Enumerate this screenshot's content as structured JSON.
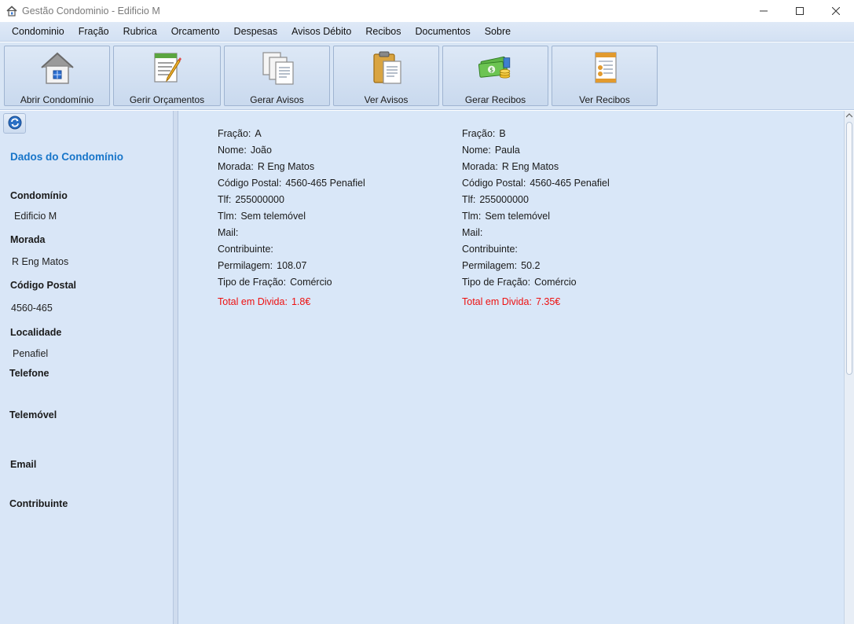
{
  "window": {
    "title": "Gestão Condominio - Edificio M",
    "icon": "home-icon"
  },
  "menu": [
    "Condominio",
    "Fração",
    "Rubrica",
    "Orcamento",
    "Despesas",
    "Avisos Débito",
    "Recibos",
    "Documentos",
    "Sobre"
  ],
  "toolbar": [
    {
      "label": "Abrir Condomínio",
      "icon": "house-icon"
    },
    {
      "label": "Gerir Orçamentos",
      "icon": "notepad-pencil-icon"
    },
    {
      "label": "Gerar Avisos",
      "icon": "documents-icon"
    },
    {
      "label": "Ver Avisos",
      "icon": "clipboard-icon"
    },
    {
      "label": "Gerar Recibos",
      "icon": "money-icon"
    },
    {
      "label": "Ver Recibos",
      "icon": "receipt-icon"
    }
  ],
  "sidebar": {
    "refresh_icon": "refresh-icon",
    "title": "Dados do Condomínio",
    "fields": [
      {
        "label": "Condomínio",
        "value": "Edificio M"
      },
      {
        "label": "Morada",
        "value": "R Eng Matos"
      },
      {
        "label": "Código Postal",
        "value": "4560-465"
      },
      {
        "label": "Localidade",
        "value": "Penafiel"
      },
      {
        "label": "Telefone",
        "value": ""
      },
      {
        "label": "Telemóvel",
        "value": ""
      },
      {
        "label": "Email",
        "value": ""
      },
      {
        "label": "Contribuinte",
        "value": ""
      }
    ]
  },
  "fracoes": [
    {
      "fracao": {
        "label": "Fração:",
        "value": "A"
      },
      "nome": {
        "label": "Nome:",
        "value": "João"
      },
      "morada": {
        "label": "Morada:",
        "value": "R Eng Matos"
      },
      "codigo_postal": {
        "label": "Código Postal:",
        "value": "4560-465 Penafiel"
      },
      "tlf": {
        "label": "Tlf:",
        "value": "255000000"
      },
      "tlm": {
        "label": "Tlm:",
        "value": "Sem telemóvel"
      },
      "mail": {
        "label": "Mail:",
        "value": ""
      },
      "contribuinte": {
        "label": "Contribuinte:",
        "value": ""
      },
      "permilagem": {
        "label": "Permilagem:",
        "value": "108.07"
      },
      "tipo": {
        "label": "Tipo de Fração:",
        "value": "Comércio"
      },
      "divida": {
        "label": "Total em Divida:",
        "value": "1.8€"
      }
    },
    {
      "fracao": {
        "label": "Fração:",
        "value": "B"
      },
      "nome": {
        "label": "Nome:",
        "value": "Paula"
      },
      "morada": {
        "label": "Morada:",
        "value": "R Eng Matos"
      },
      "codigo_postal": {
        "label": "Código Postal:",
        "value": "4560-465 Penafiel"
      },
      "tlf": {
        "label": "Tlf:",
        "value": "255000000"
      },
      "tlm": {
        "label": "Tlm:",
        "value": "Sem telemóvel"
      },
      "mail": {
        "label": "Mail:",
        "value": ""
      },
      "contribuinte": {
        "label": "Contribuinte:",
        "value": ""
      },
      "permilagem": {
        "label": "Permilagem:",
        "value": "50.2"
      },
      "tipo": {
        "label": "Tipo de Fração:",
        "value": "Comércio"
      },
      "divida": {
        "label": "Total em Divida:",
        "value": "7.35€"
      }
    }
  ],
  "colors": {
    "accent_title": "#1775c9",
    "debt": "#ee1111",
    "panel_bg": "#d9e6f7"
  }
}
